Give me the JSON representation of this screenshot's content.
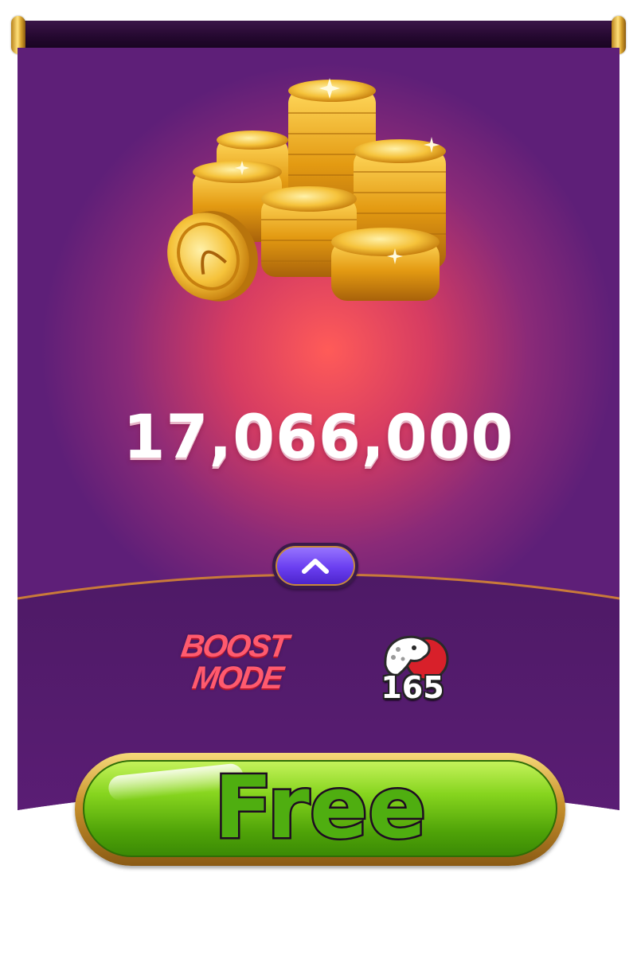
{
  "reward": {
    "amount": "17,066,000",
    "icon": "gold-coins-icon"
  },
  "expand_button": {
    "icon": "chevron-up-icon"
  },
  "boosts": {
    "boost_mode_line1": "BOOST",
    "boost_mode_line2": "MODE",
    "level": "165",
    "level_icon": "leopard-icon"
  },
  "action": {
    "label": "Free"
  },
  "colors": {
    "banner_purple": "#5e1f78",
    "glow_red": "#f25a5a",
    "button_green": "#6fc416",
    "boost_red": "#ff5a6e",
    "gold": "#f2b41c"
  }
}
